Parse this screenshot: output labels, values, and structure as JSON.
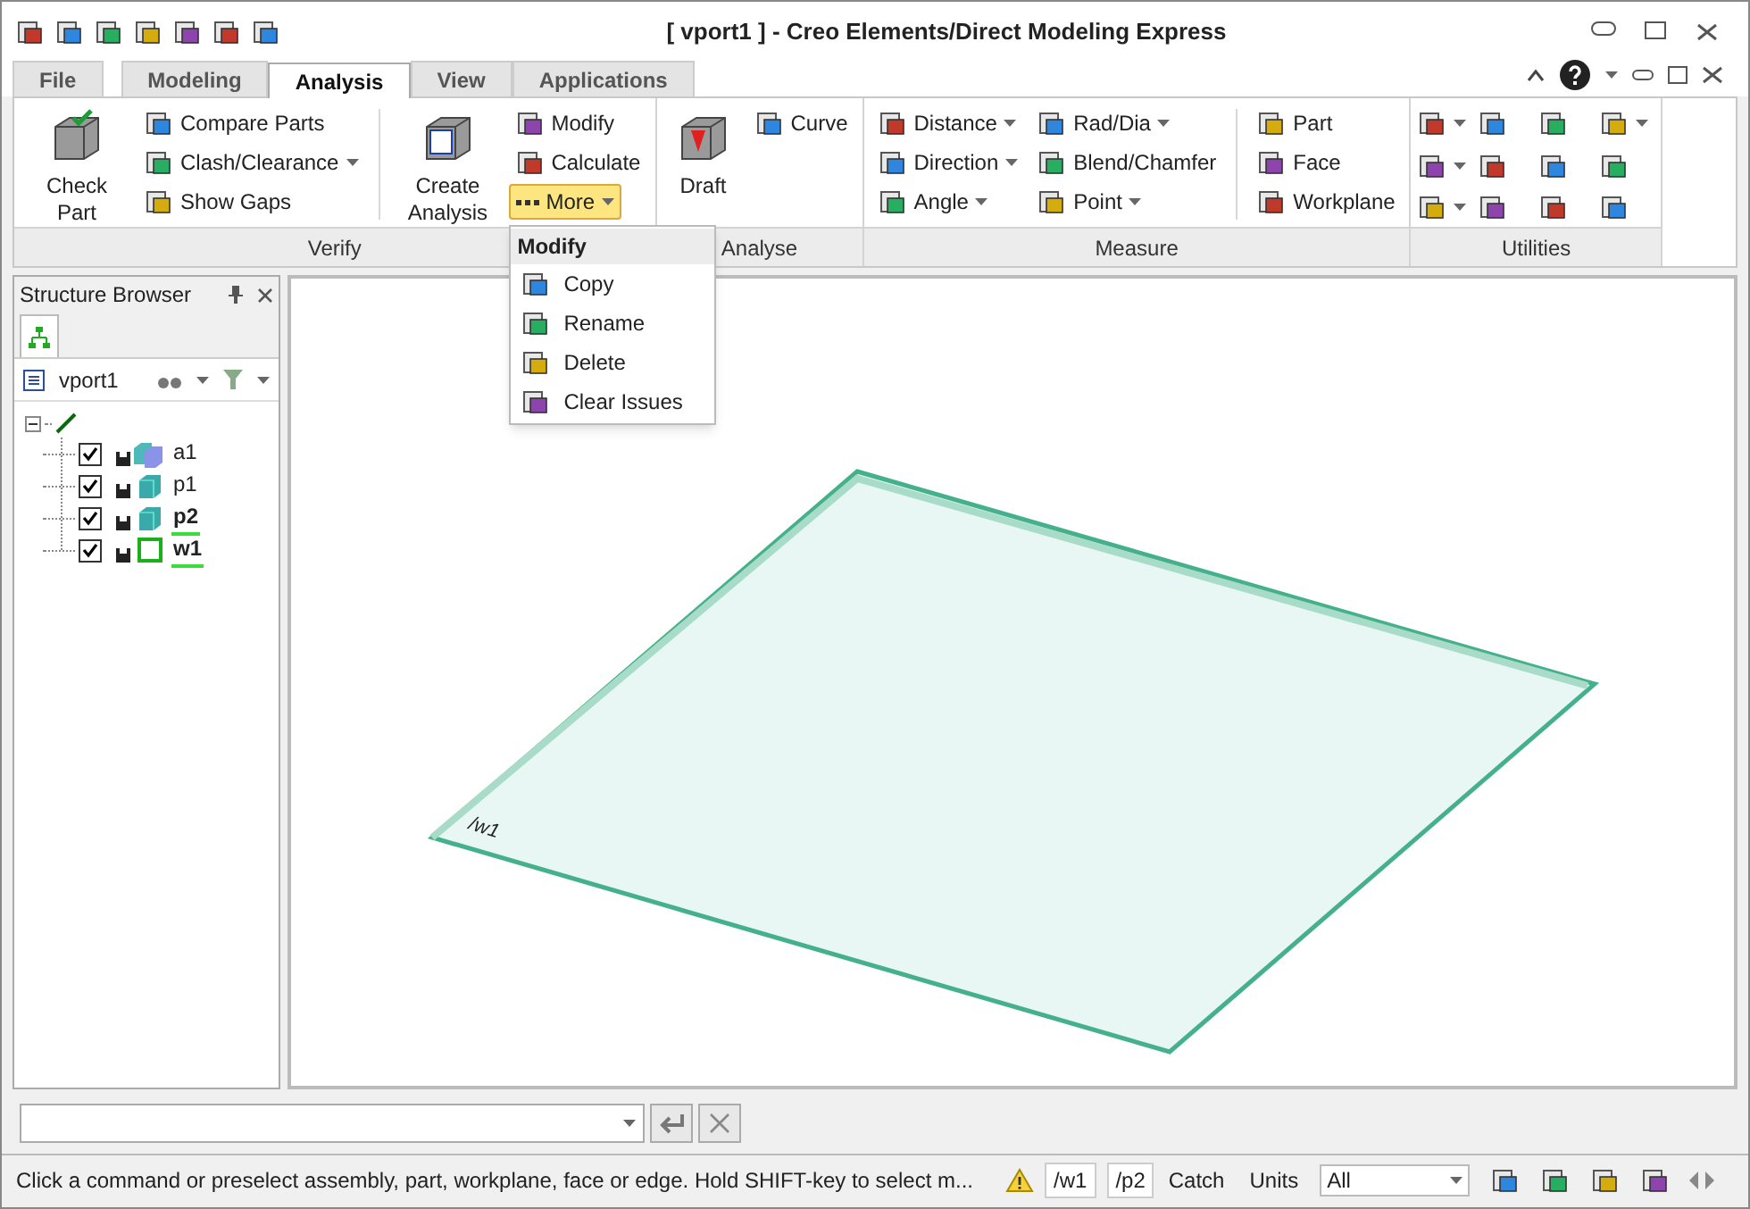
{
  "window": {
    "title": "[ vport1 ] - Creo Elements/Direct Modeling Express"
  },
  "tabs": [
    {
      "label": "File",
      "selected": false
    },
    {
      "label": "Modeling",
      "selected": false
    },
    {
      "label": "Analysis",
      "selected": true
    },
    {
      "label": "View",
      "selected": false
    },
    {
      "label": "Applications",
      "selected": false
    }
  ],
  "ribbon": {
    "groups": [
      {
        "label": "Verify",
        "columns": [
          {
            "kind": "large",
            "items": [
              {
                "label": "Check Part"
              }
            ]
          },
          {
            "kind": "small",
            "items": [
              {
                "label": "Compare Parts",
                "dropdown": false
              },
              {
                "label": "Clash/Clearance",
                "dropdown": true
              },
              {
                "label": "Show Gaps",
                "dropdown": false
              }
            ]
          },
          {
            "kind": "separator"
          },
          {
            "kind": "large",
            "items": [
              {
                "label": "Create Analysis"
              }
            ]
          },
          {
            "kind": "small",
            "items": [
              {
                "label": "Modify",
                "dropdown": false
              },
              {
                "label": "Calculate",
                "dropdown": false
              },
              {
                "label": "More",
                "dropdown": true,
                "open": true
              }
            ]
          }
        ]
      },
      {
        "label": "Analyse",
        "columns": [
          {
            "kind": "large",
            "items": [
              {
                "label": "Draft"
              }
            ]
          },
          {
            "kind": "small",
            "items": [
              {
                "label": "Curve",
                "dropdown": false
              }
            ]
          }
        ]
      },
      {
        "label": "Measure",
        "columns": [
          {
            "kind": "small",
            "items": [
              {
                "label": "Distance",
                "dropdown": true
              },
              {
                "label": "Direction",
                "dropdown": true
              },
              {
                "label": "Angle",
                "dropdown": true
              }
            ]
          },
          {
            "kind": "small",
            "items": [
              {
                "label": "Rad/Dia",
                "dropdown": true
              },
              {
                "label": "Blend/Chamfer",
                "dropdown": false
              },
              {
                "label": "Point",
                "dropdown": true
              }
            ]
          },
          {
            "kind": "separator"
          },
          {
            "kind": "small",
            "items": [
              {
                "label": "Part",
                "dropdown": false
              },
              {
                "label": "Face",
                "dropdown": false
              },
              {
                "label": "Workplane",
                "dropdown": false
              }
            ]
          }
        ]
      },
      {
        "label": "Utilities",
        "columns": [
          {
            "kind": "icons",
            "items": [
              {
                "dropdown": true
              },
              {
                "dropdown": false
              },
              {
                "dropdown": false
              },
              {
                "dropdown": true
              },
              {
                "dropdown": true
              },
              {
                "dropdown": false
              },
              {
                "dropdown": false
              },
              {
                "dropdown": false
              },
              {
                "dropdown": true
              },
              {
                "dropdown": false
              },
              {
                "dropdown": false
              },
              {
                "dropdown": false
              }
            ]
          }
        ]
      }
    ]
  },
  "menu": {
    "title": "Modify",
    "items": [
      {
        "label": "Copy"
      },
      {
        "label": "Rename"
      },
      {
        "label": "Delete"
      },
      {
        "label": "Clear Issues"
      }
    ]
  },
  "structure_browser": {
    "title": "Structure Browser",
    "viewport": "vport1",
    "tree": [
      {
        "kind": "root",
        "children": [
          {
            "label": "a1",
            "kind": "assembly",
            "checked": true,
            "active": false
          },
          {
            "label": "p1",
            "kind": "part",
            "checked": true,
            "active": false
          },
          {
            "label": "p2",
            "kind": "part",
            "checked": true,
            "active": true
          },
          {
            "label": "w1",
            "kind": "workplane",
            "checked": true,
            "active": true
          }
        ]
      }
    ]
  },
  "viewport": {
    "workplane_label": "/w1"
  },
  "status_bar": {
    "message": "Click a command or preselect assembly, part, workplane, face or edge. Hold SHIFT-key to select m...",
    "workplane": "/w1",
    "part": "/p2",
    "catch": "Catch",
    "units": "Units",
    "filter": "All"
  }
}
